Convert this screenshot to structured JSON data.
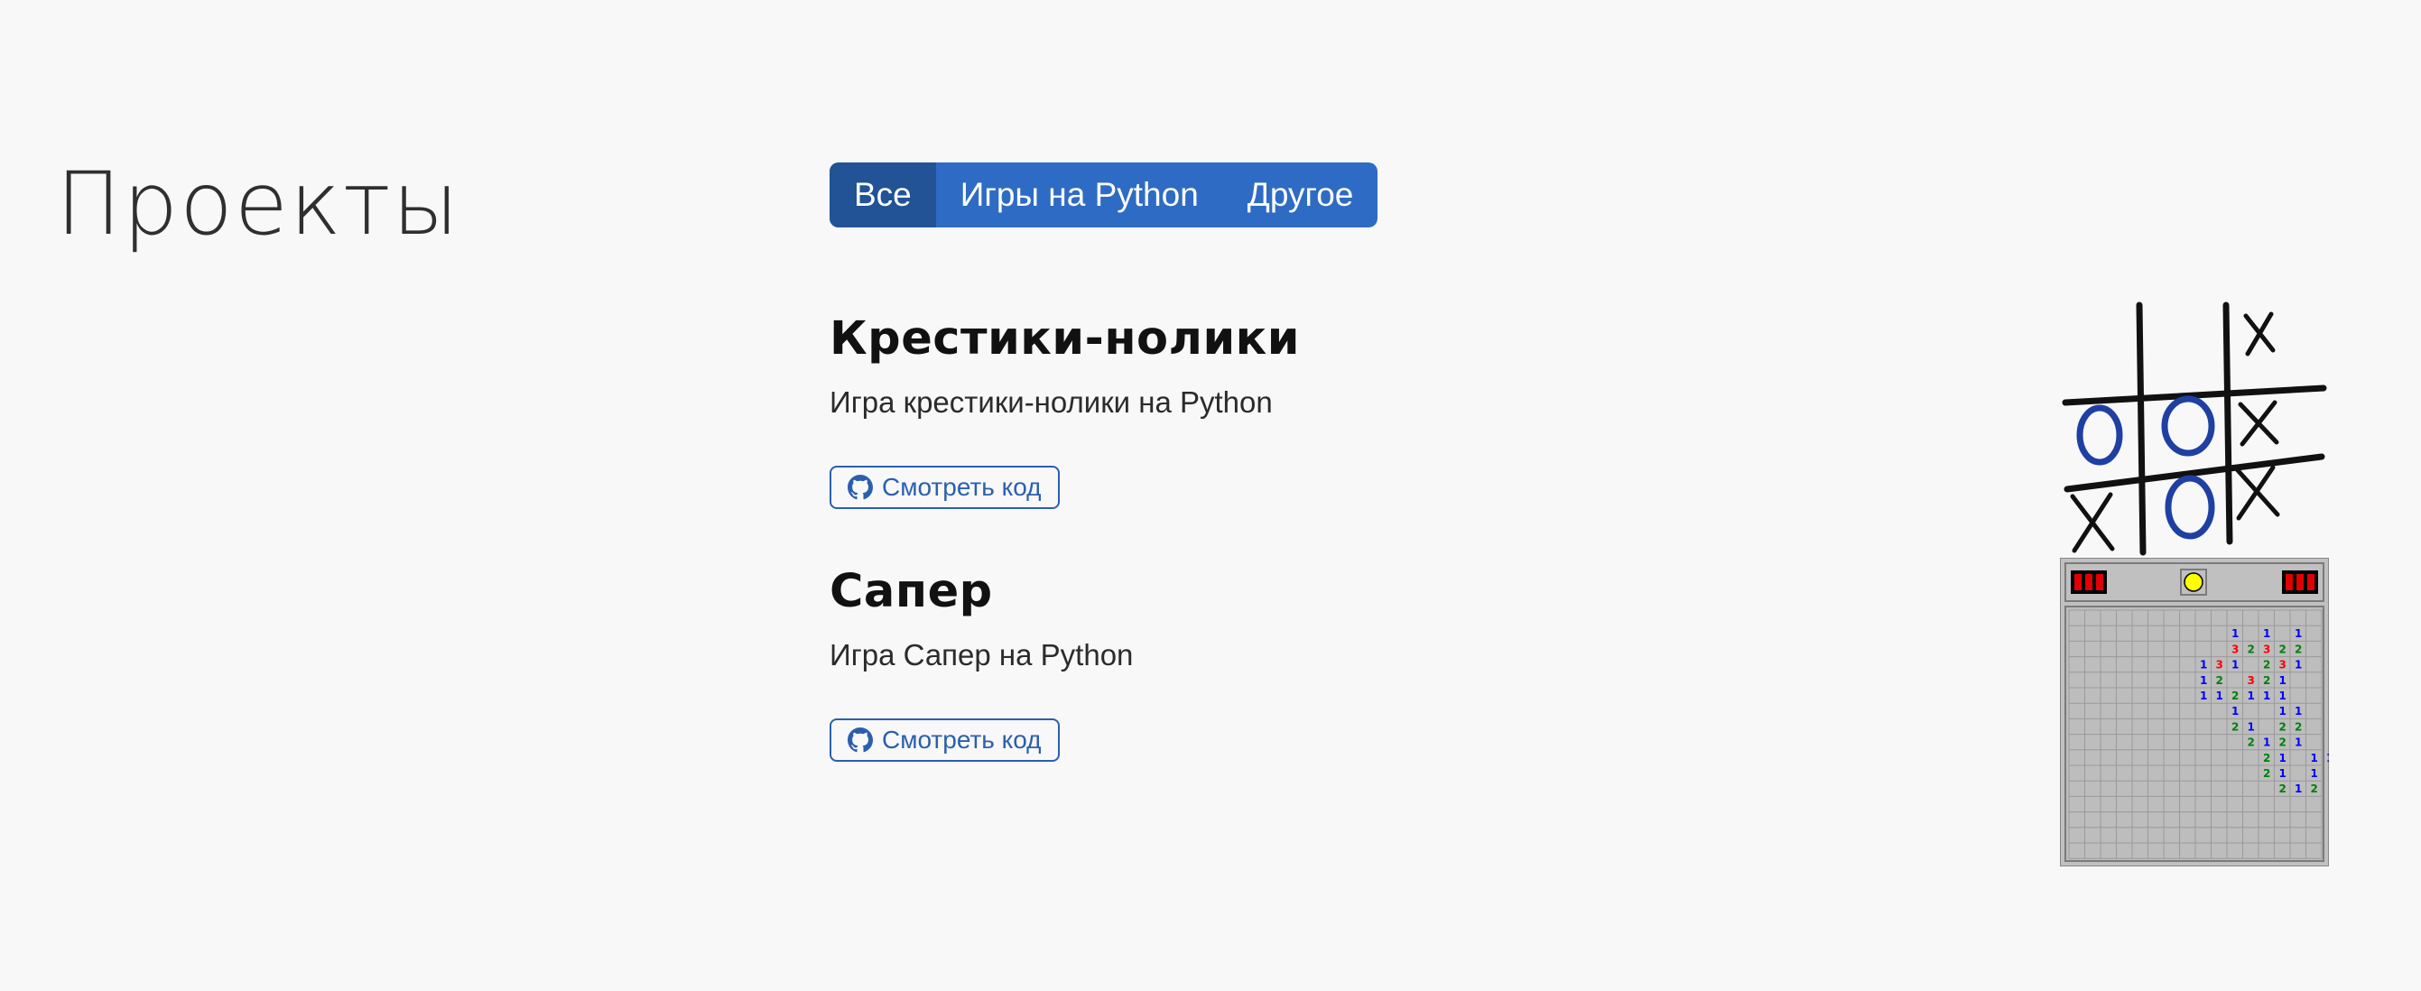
{
  "page": {
    "title": "Проекты"
  },
  "filters": [
    {
      "label": "Все",
      "active": true
    },
    {
      "label": "Игры на Python",
      "active": false
    },
    {
      "label": "Другое",
      "active": false
    }
  ],
  "projects": [
    {
      "title": "Крестики-нолики",
      "description": "Игра крестики-нолики на Python",
      "button_label": "Смотреть код",
      "icon": "github-icon"
    },
    {
      "title": "Сапер",
      "description": "Игра Сапер на Python",
      "button_label": "Смотреть код",
      "icon": "github-icon"
    }
  ],
  "colors": {
    "accent": "#2e6bc4",
    "accent_active": "#215396",
    "background": "#f8f8f9",
    "tictactoe_o": "#1f3fa3"
  }
}
